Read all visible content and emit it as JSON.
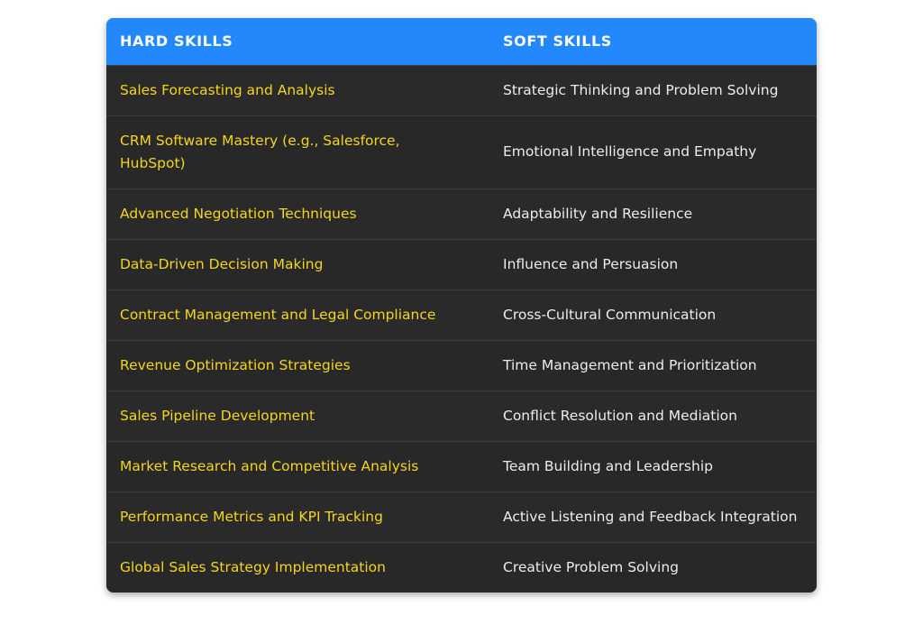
{
  "table": {
    "headers": {
      "hard": "HARD SKILLS",
      "soft": "SOFT SKILLS"
    },
    "rows": [
      {
        "hard": "Sales Forecasting and Analysis",
        "soft": "Strategic Thinking and Problem Solving"
      },
      {
        "hard": "CRM Software Mastery (e.g., Salesforce, HubSpot)",
        "soft": "Emotional Intelligence and Empathy"
      },
      {
        "hard": "Advanced Negotiation Techniques",
        "soft": "Adaptability and Resilience"
      },
      {
        "hard": "Data-Driven Decision Making",
        "soft": "Influence and Persuasion"
      },
      {
        "hard": "Contract Management and Legal Compliance",
        "soft": "Cross-Cultural Communication"
      },
      {
        "hard": "Revenue Optimization Strategies",
        "soft": "Time Management and Prioritization"
      },
      {
        "hard": "Sales Pipeline Development",
        "soft": "Conflict Resolution and Mediation"
      },
      {
        "hard": "Market Research and Competitive Analysis",
        "soft": "Team Building and Leadership"
      },
      {
        "hard": "Performance Metrics and KPI Tracking",
        "soft": "Active Listening and Feedback Integration"
      },
      {
        "hard": "Global Sales Strategy Implementation",
        "soft": "Creative Problem Solving"
      }
    ]
  },
  "colors": {
    "header_bg": "#2388fb",
    "body_bg": "#262626",
    "hard_text": "#f4d51e",
    "soft_text": "#ececec"
  }
}
